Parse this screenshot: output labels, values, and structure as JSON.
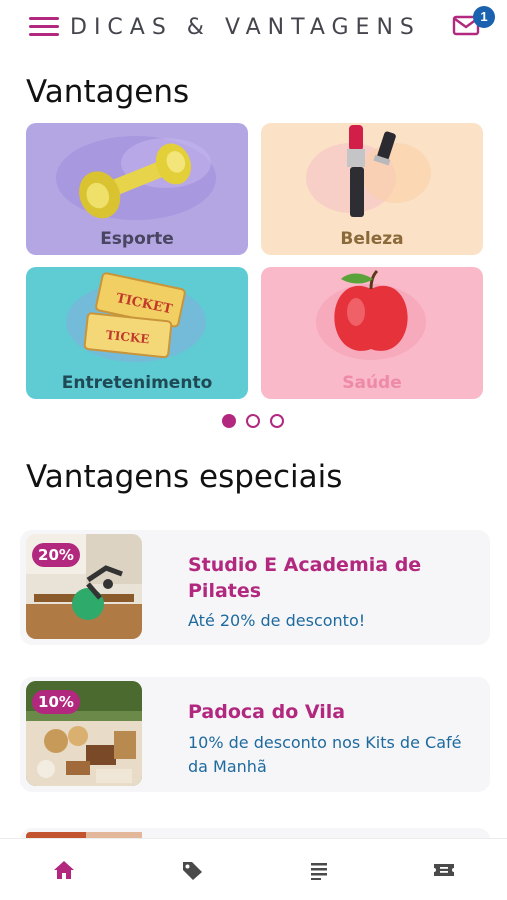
{
  "header": {
    "brand": "DICAS & VANTAGENS",
    "notification_count": "1",
    "accent_color": "#b2287f",
    "badge_color": "#1a62b0"
  },
  "vantagens": {
    "title": "Vantagens",
    "categories": [
      {
        "label": "Esporte",
        "icon": "dumbbell-icon",
        "bg": "#b3a6e3",
        "label_color": "#4a4560"
      },
      {
        "label": "Beleza",
        "icon": "lipstick-mascara-icon",
        "bg": "#fbe2c6",
        "label_color": "#8a6a3a"
      },
      {
        "label": "Entretenimento",
        "icon": "ticket-icon",
        "bg": "#5fcbd3",
        "label_color": "#1f4a55"
      },
      {
        "label": "Saúde",
        "icon": "apple-icon",
        "bg": "#f9b9c8",
        "label_color": "#ee8aa8"
      }
    ],
    "pagination": {
      "pages": 3,
      "active": 1
    }
  },
  "especiais": {
    "title": "Vantagens especiais",
    "offers": [
      {
        "badge": "20%",
        "title": "Studio E Academia de Pilates",
        "description": "Até 20% de desconto!",
        "image": "pilates-photo"
      },
      {
        "badge": "10%",
        "title": "Padoca do Vila",
        "description": "10% de desconto nos Kits de Café da Manhã",
        "image": "bakery-photo"
      }
    ]
  },
  "bottom_nav": [
    {
      "icon": "home-icon",
      "active": true
    },
    {
      "icon": "tag-icon",
      "active": false
    },
    {
      "icon": "list-icon",
      "active": false
    },
    {
      "icon": "ticket-icon",
      "active": false
    }
  ]
}
